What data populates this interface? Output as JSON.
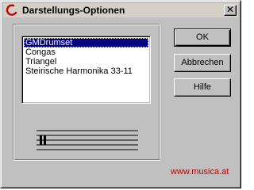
{
  "window": {
    "title": "Darstellungs-Optionen",
    "close_label": "✕"
  },
  "instrument_list": {
    "items": [
      {
        "label": "GMDrumset",
        "selected": true
      },
      {
        "label": "Congas",
        "selected": false
      },
      {
        "label": "Triangel",
        "selected": false
      },
      {
        "label": "Steirische Harmonika 33-11",
        "selected": false
      }
    ]
  },
  "buttons": {
    "ok": "OK",
    "cancel": "Abbrechen",
    "help": "Hilfe"
  },
  "website": "www.musica.at",
  "colors": {
    "selection": "#000080",
    "link": "#c00000",
    "face": "#c0c0c0"
  },
  "icons": {
    "app": "red-crescent-icon",
    "staff": "percussion-staff-icon"
  }
}
